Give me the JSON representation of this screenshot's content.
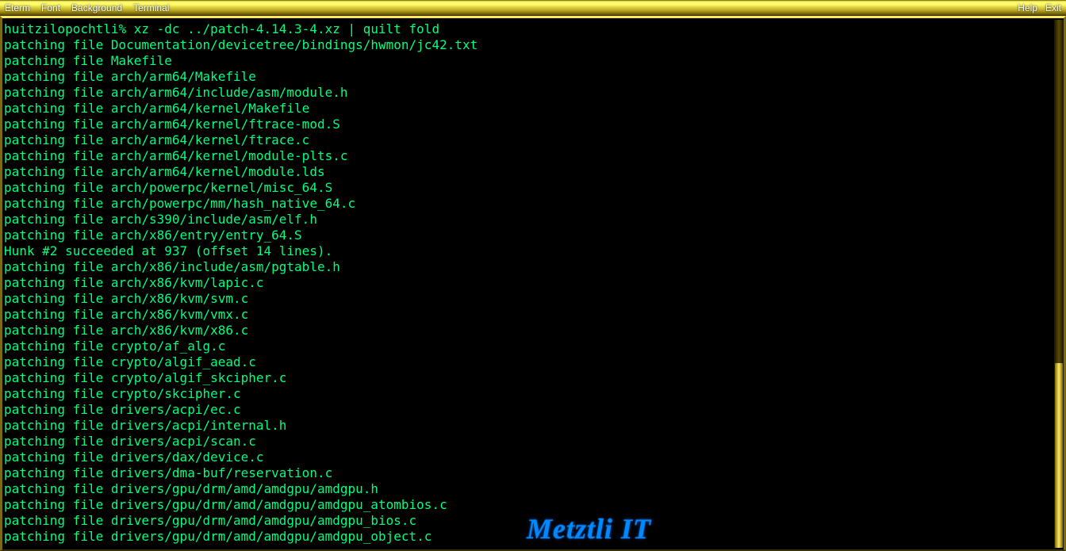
{
  "menubar": {
    "left": [
      "Eterm",
      "Font",
      "Background",
      "Terminal"
    ],
    "right": [
      "Help",
      "Exit"
    ]
  },
  "watermark": "Metztli IT",
  "scroll": {
    "thumb_top_pct": 65,
    "thumb_height_pct": 35
  },
  "terminal_lines": [
    "huitzilopochtli% xz -dc ../patch-4.14.3-4.xz | quilt fold",
    "patching file Documentation/devicetree/bindings/hwmon/jc42.txt",
    "patching file Makefile",
    "patching file arch/arm64/Makefile",
    "patching file arch/arm64/include/asm/module.h",
    "patching file arch/arm64/kernel/Makefile",
    "patching file arch/arm64/kernel/ftrace-mod.S",
    "patching file arch/arm64/kernel/ftrace.c",
    "patching file arch/arm64/kernel/module-plts.c",
    "patching file arch/arm64/kernel/module.lds",
    "patching file arch/powerpc/kernel/misc_64.S",
    "patching file arch/powerpc/mm/hash_native_64.c",
    "patching file arch/s390/include/asm/elf.h",
    "patching file arch/x86/entry/entry_64.S",
    "Hunk #2 succeeded at 937 (offset 14 lines).",
    "patching file arch/x86/include/asm/pgtable.h",
    "patching file arch/x86/kvm/lapic.c",
    "patching file arch/x86/kvm/svm.c",
    "patching file arch/x86/kvm/vmx.c",
    "patching file arch/x86/kvm/x86.c",
    "patching file crypto/af_alg.c",
    "patching file crypto/algif_aead.c",
    "patching file crypto/algif_skcipher.c",
    "patching file crypto/skcipher.c",
    "patching file drivers/acpi/ec.c",
    "patching file drivers/acpi/internal.h",
    "patching file drivers/acpi/scan.c",
    "patching file drivers/dax/device.c",
    "patching file drivers/dma-buf/reservation.c",
    "patching file drivers/gpu/drm/amd/amdgpu/amdgpu.h",
    "patching file drivers/gpu/drm/amd/amdgpu/amdgpu_atombios.c",
    "patching file drivers/gpu/drm/amd/amdgpu/amdgpu_bios.c",
    "patching file drivers/gpu/drm/amd/amdgpu/amdgpu_object.c"
  ]
}
